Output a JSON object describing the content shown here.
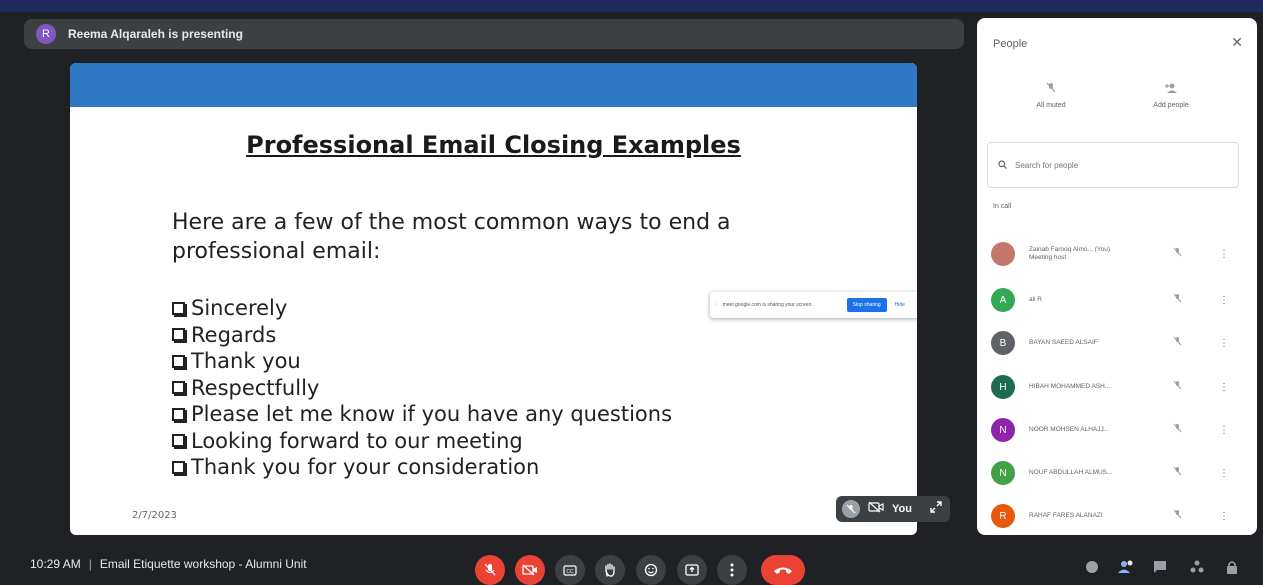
{
  "presenter": {
    "avatar_initial": "R",
    "text": "Reema Alqaraleh is presenting"
  },
  "slide": {
    "title": "Professional Email Closing Examples",
    "intro": "Here are a few of the most common ways to end a professional email:",
    "items": [
      "Sincerely",
      "Regards",
      "Thank you",
      "Respectfully",
      "Please let me know if you have any questions",
      "Looking forward to our meeting",
      "Thank you for your consideration"
    ],
    "date": "2/7/2023"
  },
  "share_popup": {
    "text": "meet.google.com is sharing your screen.",
    "stop_label": "Stop sharing",
    "hide_label": "Hide"
  },
  "self_view": {
    "label": "You"
  },
  "people_panel": {
    "title": "People",
    "all_muted_label": "All muted",
    "add_people_label": "Add people",
    "search_placeholder": "Search for people",
    "in_call_label": "In call",
    "participants": [
      {
        "initial": "",
        "name": "Zainab Farooq Almo... (You)",
        "sub": "Meeting host",
        "color": "#c5776b"
      },
      {
        "initial": "A",
        "name": "ali R",
        "sub": "",
        "color": "#34a853"
      },
      {
        "initial": "B",
        "name": "BAYAN SAEED ALSAIF",
        "sub": "",
        "color": "#5f6368"
      },
      {
        "initial": "H",
        "name": "HIBAH MOHAMMED ASH...",
        "sub": "",
        "color": "#1e6b4f"
      },
      {
        "initial": "N",
        "name": "NOOR MOHSEN ALHAJJ...",
        "sub": "",
        "color": "#8e24aa"
      },
      {
        "initial": "N",
        "name": "NOUF ABDULLAH ALMUS...",
        "sub": "",
        "color": "#43a047"
      },
      {
        "initial": "R",
        "name": "RAHAF FARES ALANAZI",
        "sub": "",
        "color": "#e8580c"
      }
    ]
  },
  "bottom_bar": {
    "time": "10:29 AM",
    "meeting_name": "Email Etiquette workshop - Alumni Unit"
  },
  "colors": {
    "slide_band": "#2f79c4",
    "end_call": "#ea4335",
    "presenter_bar": "#3c4043"
  }
}
